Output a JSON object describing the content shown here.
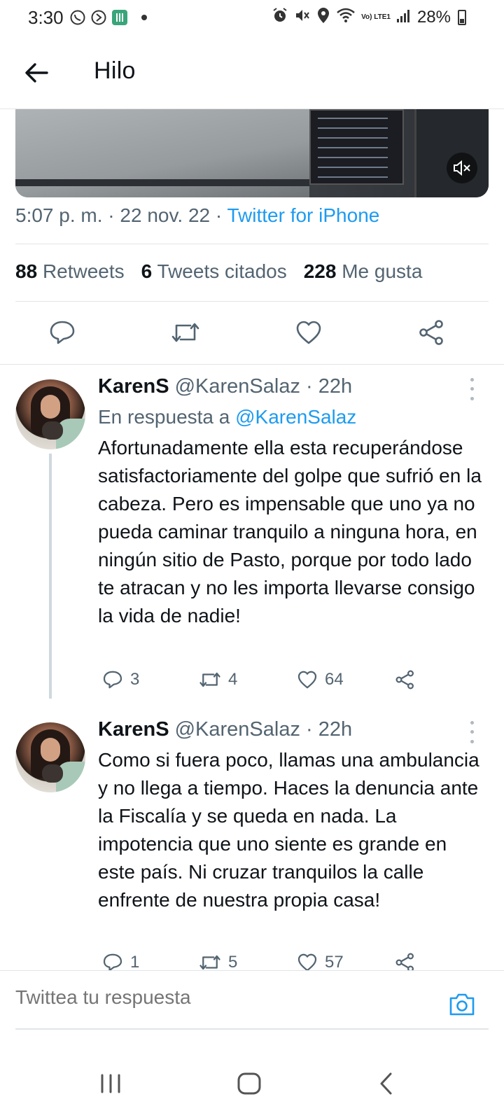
{
  "status_bar": {
    "time": "3:30",
    "battery": "28%",
    "network": "Vo) LTE1",
    "icons_left": [
      "whatsapp-icon",
      "whatsapp-business-icon",
      "app-icon",
      "dot-icon"
    ],
    "icons_right": [
      "alarm-icon",
      "mute-icon",
      "location-icon",
      "wifi-icon",
      "lte-icon",
      "signal-icon",
      "battery-icon"
    ]
  },
  "header": {
    "title": "Hilo"
  },
  "tweet_main": {
    "meta_time": "5:07 p. m. · 22 nov. 22 · ",
    "meta_source": "Twitter for iPhone",
    "stats": {
      "retweets_count": "88",
      "retweets_label": "Retweets",
      "quotes_count": "6",
      "quotes_label": "Tweets citados",
      "likes_count": "228",
      "likes_label": "Me gusta"
    }
  },
  "replies": [
    {
      "name": "KarenS",
      "handle_time": "@KarenSalaz · 22h",
      "reply_prefix": "En respuesta a ",
      "reply_handle": "@KarenSalaz",
      "text": "Afortunadamente ella esta recuperándose satisfactoriamente del golpe que sufrió en la cabeza. Pero es impensable que uno ya no pueda caminar tranquilo a ninguna hora, en ningún sitio de Pasto, porque por todo lado te atracan y no les importa llevarse consigo la vida de nadie!",
      "replies": "3",
      "retweets": "4",
      "likes": "64"
    },
    {
      "name": "KarenS",
      "handle_time": "@KarenSalaz · 22h",
      "text": "Como si fuera poco, llamas una ambulancia y no llega a tiempo. Haces la denuncia ante la Fiscalía y se queda en nada. La impotencia que uno siente es grande en este país. Ni cruzar tranquilos la calle enfrente de nuestra propia casa!",
      "replies": "1",
      "retweets": "5",
      "likes": "57"
    }
  ],
  "compose": {
    "placeholder": "Twittea tu respuesta"
  },
  "colors": {
    "accent": "#1d9bf0",
    "text_primary": "#0f1419",
    "text_secondary": "#536471",
    "divider": "#e1e5e8"
  }
}
